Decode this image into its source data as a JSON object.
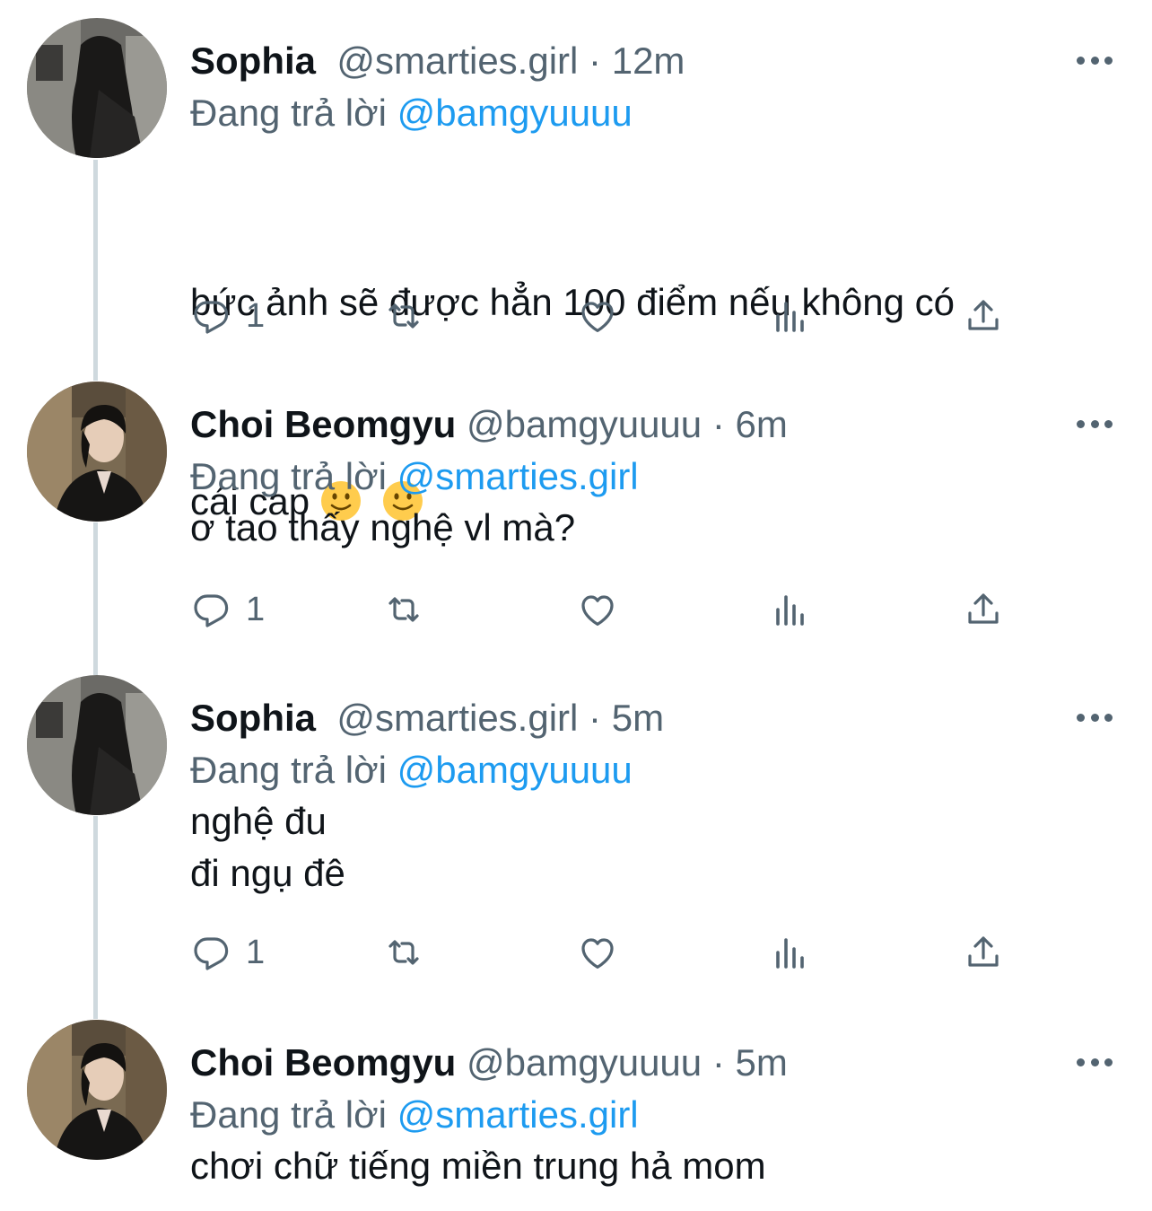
{
  "reply_prefix": "Đang trả lời",
  "tweets": [
    {
      "name": "Sophia",
      "handle": "@smarties.girl",
      "separator": "·",
      "time": "12m",
      "reply_to": "@bamgyuuuu",
      "text_line1": "bức ảnh sẽ được hẳn 100 điểm nếu không có",
      "text_line2": "cái cap",
      "emoji": [
        "slightly-smiling-face",
        "slightly-smiling-face"
      ],
      "reply_count": "1"
    },
    {
      "name": "Choi Beomgyu",
      "handle": "@bamgyuuuu",
      "separator": "·",
      "time": "6m",
      "reply_to": "@smarties.girl",
      "text": "ơ tao thấy nghệ vl mà?",
      "reply_count": "1"
    },
    {
      "name": "Sophia",
      "handle": "@smarties.girl",
      "separator": "·",
      "time": "5m",
      "reply_to": "@bamgyuuuu",
      "text": "nghệ đu\nđi ngụ đê",
      "reply_count": "1"
    },
    {
      "name": "Choi Beomgyu",
      "handle": "@bamgyuuuu",
      "separator": "·",
      "time": "5m",
      "reply_to": "@smarties.girl",
      "text": "chơi chữ tiếng miền trung hả mom"
    }
  ],
  "icons": {
    "reply": "reply-icon",
    "retweet": "retweet-icon",
    "like": "heart-icon",
    "views": "analytics-icon",
    "share": "share-icon",
    "more": "more-icon"
  },
  "colors": {
    "mention": "#1d9bf0",
    "secondary": "#536471",
    "thread_line": "#cfd9de"
  }
}
